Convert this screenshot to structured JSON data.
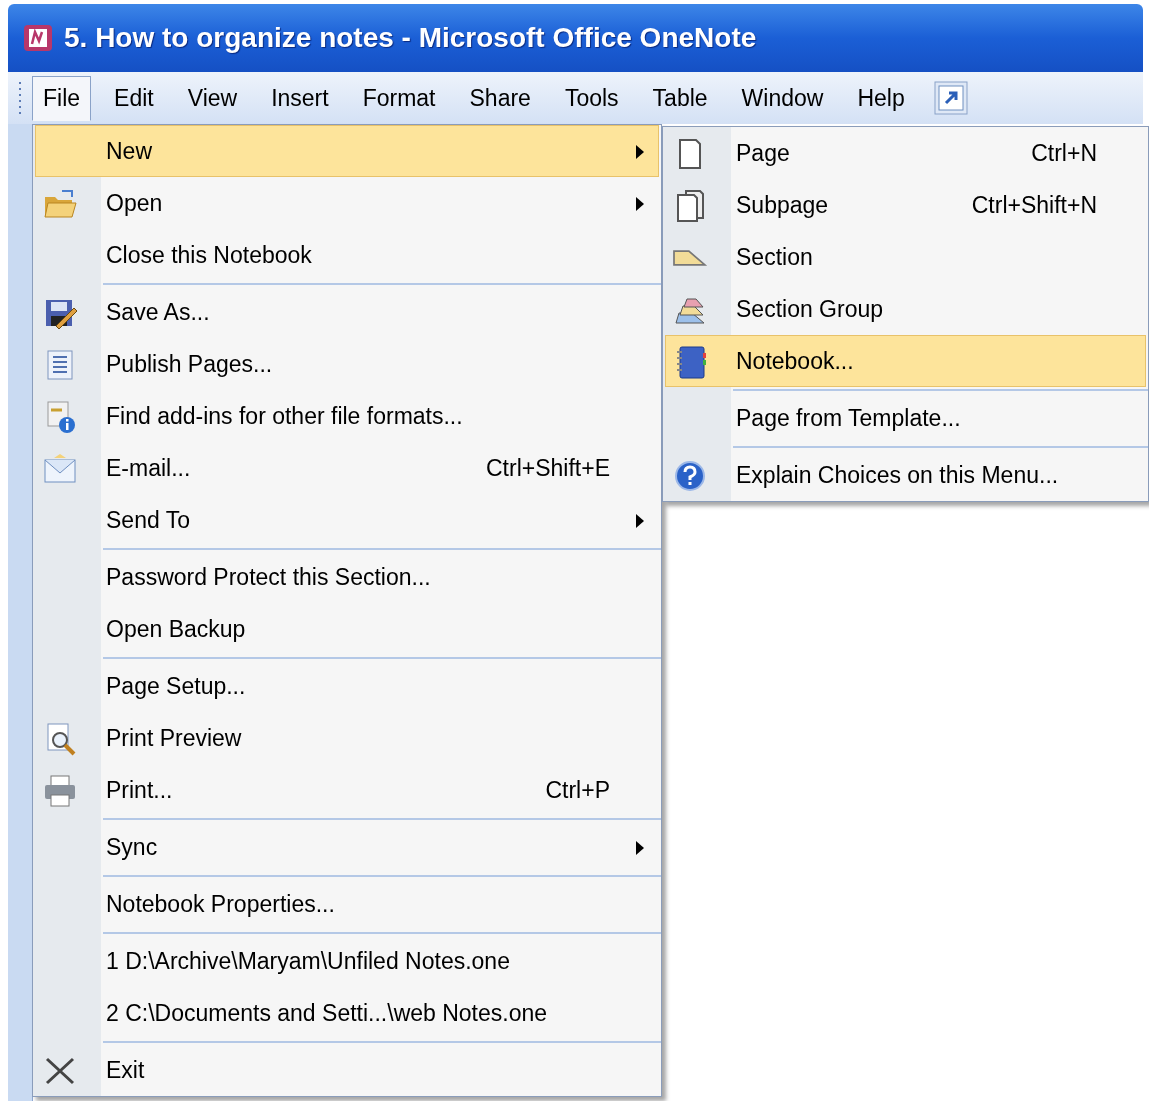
{
  "window": {
    "title": "5. How to organize notes - Microsoft Office OneNote"
  },
  "menu_bar": {
    "items": [
      {
        "label": "File",
        "selected": true
      },
      {
        "label": "Edit",
        "selected": false
      },
      {
        "label": "View",
        "selected": false
      },
      {
        "label": "Insert",
        "selected": false
      },
      {
        "label": "Format",
        "selected": false
      },
      {
        "label": "Share",
        "selected": false
      },
      {
        "label": "Tools",
        "selected": false
      },
      {
        "label": "Table",
        "selected": false
      },
      {
        "label": "Window",
        "selected": false
      },
      {
        "label": "Help",
        "selected": false
      }
    ]
  },
  "file_menu": {
    "groups": [
      [
        {
          "label": "New",
          "has_submenu": true,
          "selected": true
        },
        {
          "label": "Open",
          "has_submenu": true,
          "selected": false
        },
        {
          "label": "Close this Notebook",
          "has_submenu": false,
          "selected": false
        }
      ],
      [
        {
          "label": "Save As...",
          "has_submenu": false,
          "selected": false
        },
        {
          "label": "Publish Pages...",
          "has_submenu": false,
          "selected": false
        },
        {
          "label": "Find add-ins for other file formats...",
          "has_submenu": false,
          "selected": false
        },
        {
          "label": "E-mail...",
          "shortcut": "Ctrl+Shift+E",
          "has_submenu": false,
          "selected": false
        },
        {
          "label": "Send To",
          "has_submenu": true,
          "selected": false
        }
      ],
      [
        {
          "label": "Password Protect this Section...",
          "has_submenu": false,
          "selected": false
        },
        {
          "label": "Open Backup",
          "has_submenu": false,
          "selected": false
        }
      ],
      [
        {
          "label": "Page Setup...",
          "has_submenu": false,
          "selected": false
        },
        {
          "label": "Print Preview",
          "has_submenu": false,
          "selected": false
        },
        {
          "label": "Print...",
          "shortcut": "Ctrl+P",
          "has_submenu": false,
          "selected": false
        }
      ],
      [
        {
          "label": "Sync",
          "has_submenu": true,
          "selected": false
        }
      ],
      [
        {
          "label": "Notebook Properties...",
          "has_submenu": false,
          "selected": false
        }
      ],
      [
        {
          "label": "1 D:\\Archive\\Maryam\\Unfiled Notes.one",
          "has_submenu": false,
          "selected": false
        },
        {
          "label": "2 C:\\Documents and Setti...\\web Notes.one",
          "has_submenu": false,
          "selected": false
        }
      ],
      [
        {
          "label": "Exit",
          "has_submenu": false,
          "selected": false
        }
      ]
    ]
  },
  "new_submenu": {
    "groups": [
      [
        {
          "label": "Page",
          "shortcut": "Ctrl+N",
          "selected": false
        },
        {
          "label": "Subpage",
          "shortcut": "Ctrl+Shift+N",
          "selected": false
        },
        {
          "label": "Section",
          "selected": false
        },
        {
          "label": "Section Group",
          "selected": false
        },
        {
          "label": "Notebook...",
          "selected": true
        }
      ],
      [
        {
          "label": "Page from Template...",
          "selected": false
        }
      ],
      [
        {
          "label": "Explain Choices on this Menu...",
          "selected": false
        }
      ]
    ]
  }
}
